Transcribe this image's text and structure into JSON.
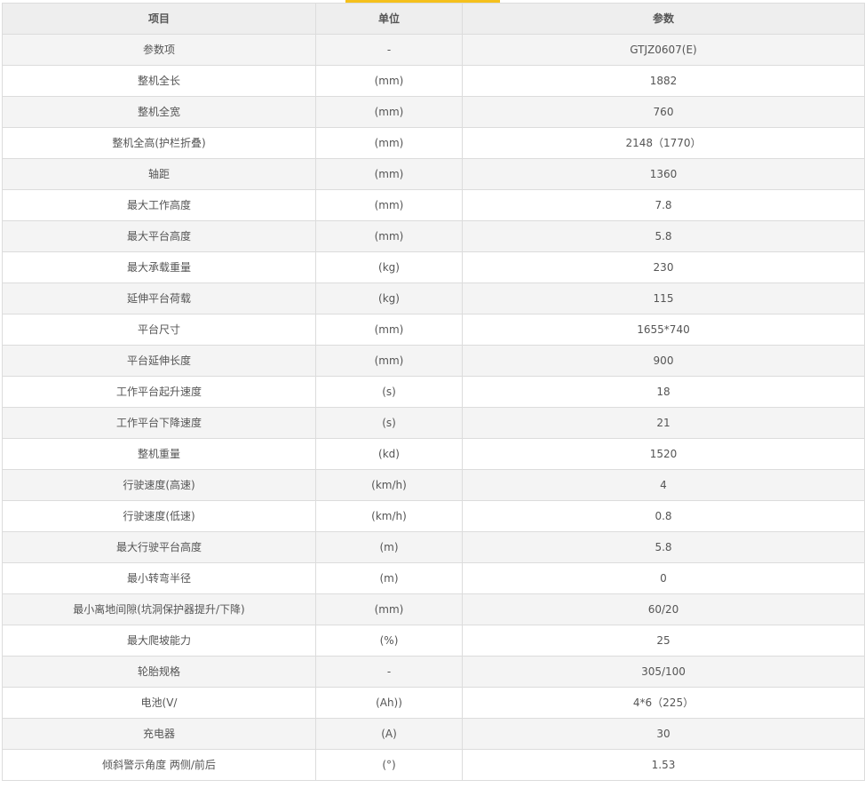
{
  "colors": {
    "accent": "#f5c01c",
    "header_bg": "#eeeeee",
    "row_alt_bg": "#f4f4f4",
    "border": "#dcdcdc",
    "text": "#555555"
  },
  "table": {
    "headers": [
      "项目",
      "单位",
      "参数"
    ],
    "rows": [
      [
        "参数项",
        "-",
        "GTJZ0607(E)"
      ],
      [
        "整机全长",
        "(mm)",
        "1882"
      ],
      [
        "整机全宽",
        "(mm)",
        "760"
      ],
      [
        "整机全高(护栏折叠)",
        "(mm)",
        "2148（1770）"
      ],
      [
        "轴距",
        "(mm)",
        "1360"
      ],
      [
        "最大工作高度",
        "(mm)",
        "7.8"
      ],
      [
        "最大平台高度",
        "(mm)",
        "5.8"
      ],
      [
        "最大承载重量",
        "(kg)",
        "230"
      ],
      [
        "延伸平台荷载",
        "(kg)",
        "115"
      ],
      [
        "平台尺寸",
        "(mm)",
        "1655*740"
      ],
      [
        "平台延伸长度",
        "(mm)",
        "900"
      ],
      [
        "工作平台起升速度",
        "(s)",
        "18"
      ],
      [
        "工作平台下降速度",
        "(s)",
        "21"
      ],
      [
        "整机重量",
        "(kd)",
        "1520"
      ],
      [
        "行驶速度(高速)",
        "(km/h)",
        "4"
      ],
      [
        "行驶速度(低速)",
        "(km/h)",
        "0.8"
      ],
      [
        "最大行驶平台高度",
        "(m)",
        "5.8"
      ],
      [
        "最小转弯半径",
        "(m)",
        "0"
      ],
      [
        "最小离地间隙(坑洞保护器提升/下降)",
        "(mm)",
        "60/20"
      ],
      [
        "最大爬坡能力",
        "(%)",
        "25"
      ],
      [
        "轮胎规格",
        "-",
        "305/100"
      ],
      [
        "电池(V/",
        "(Ah))",
        "4*6（225）"
      ],
      [
        "充电器",
        "(A)",
        "30"
      ],
      [
        "倾斜警示角度 两侧/前后",
        "(°)",
        "1.53"
      ]
    ]
  }
}
